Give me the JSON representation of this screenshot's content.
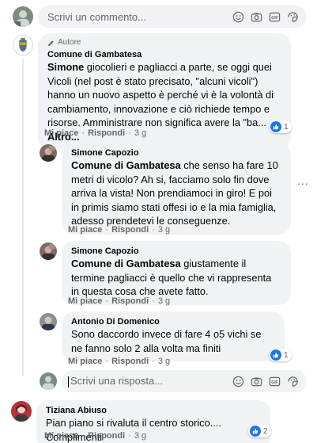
{
  "top_input": {
    "placeholder": "Scrivi un commento..."
  },
  "comment1": {
    "badge": "Autore",
    "author": "Comune di Gambatesa",
    "mention": "Simone",
    "text": " giocolieri e pagliacci a parte, se oggi quei Vicoli (nel post è stato precisato, \"alcuni vicoli\") hanno un nuovo aspetto è perché vi è la volontà di cambiamento, innovazione e ciò richiede tempo e risorse. Amministrare non significa avere la \"ba... ",
    "more": "Altro...",
    "like": "Mi piace",
    "reply": "Rispondi",
    "time": "3 g",
    "reactions": "1"
  },
  "reply1": {
    "author": "Simone Capozio",
    "mention": "Comune di Gambatesa",
    "text": " che senso ha fare 10 metri di vicolo? Ah si, facciamo solo fin dove arriva la vista! Non prendiamoci in giro! E poi in primis siamo stati offesi io e la mia famiglia, adesso prendetevi le conseguenze.",
    "like": "Mi piace",
    "reply": "Rispondi",
    "time": "3 g",
    "options": "..."
  },
  "reply2": {
    "author": "Simone Capozio",
    "mention": "Comune di Gambatesa",
    "text": " giustamente il termine pagliacci è quello che vi rappresenta in questa cosa che avete fatto.",
    "like": "Mi piace",
    "reply": "Rispondi",
    "time": "3 g"
  },
  "reply3": {
    "author": "Antonio Di Domenico",
    "text": "Sono daccordo invece di fare 4 o5 vichi se ne fanno solo 2 alla volta ma finiti",
    "like": "Mi piace",
    "reply": "Rispondi",
    "time": "3 g",
    "reactions": "1"
  },
  "reply_input": {
    "placeholder": "Scrivi una risposta..."
  },
  "comment2": {
    "author": "Tiziana Abiuso",
    "text": "Pian piano si rivaluta il centro storico.... Complimenti",
    "like": "Mi piace",
    "reply": "Rispondi",
    "time": "3 g",
    "reactions": "2"
  },
  "colors": {
    "bubble": "#f0f2f5",
    "like_blue": "#1877f2",
    "meta_gray": "#65676b"
  },
  "icons": [
    "emoji-icon",
    "camera-icon",
    "gif-icon",
    "sticker-icon",
    "like-reaction-icon",
    "pencil-icon"
  ]
}
